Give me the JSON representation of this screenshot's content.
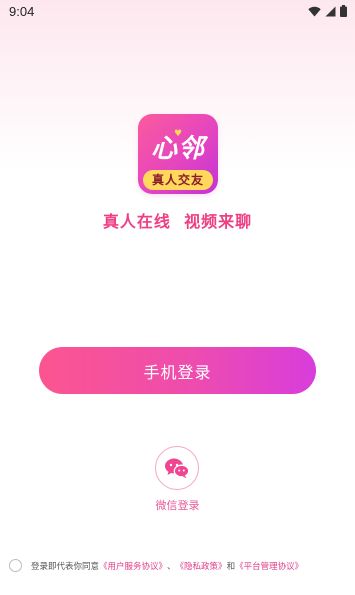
{
  "status_bar": {
    "time": "9:04"
  },
  "logo": {
    "main_text": "心邻",
    "sub_text": "真人交友"
  },
  "slogan": "真人在线  视频来聊",
  "phone_login_label": "手机登录",
  "wechat_login_label": "微信登录",
  "agreement": {
    "prefix": "登录即代表你同意",
    "user_agreement": "《用户服务协议》",
    "sep1": "、",
    "privacy_policy": "《隐私政策》",
    "sep2": "和",
    "platform_agreement": "《平台管理协议》"
  },
  "colors": {
    "accent_pink": "#ee3f85",
    "gradient_start": "#fb5590",
    "gradient_end": "#d83ddc",
    "logo_badge_yellow": "#ffd85c"
  }
}
